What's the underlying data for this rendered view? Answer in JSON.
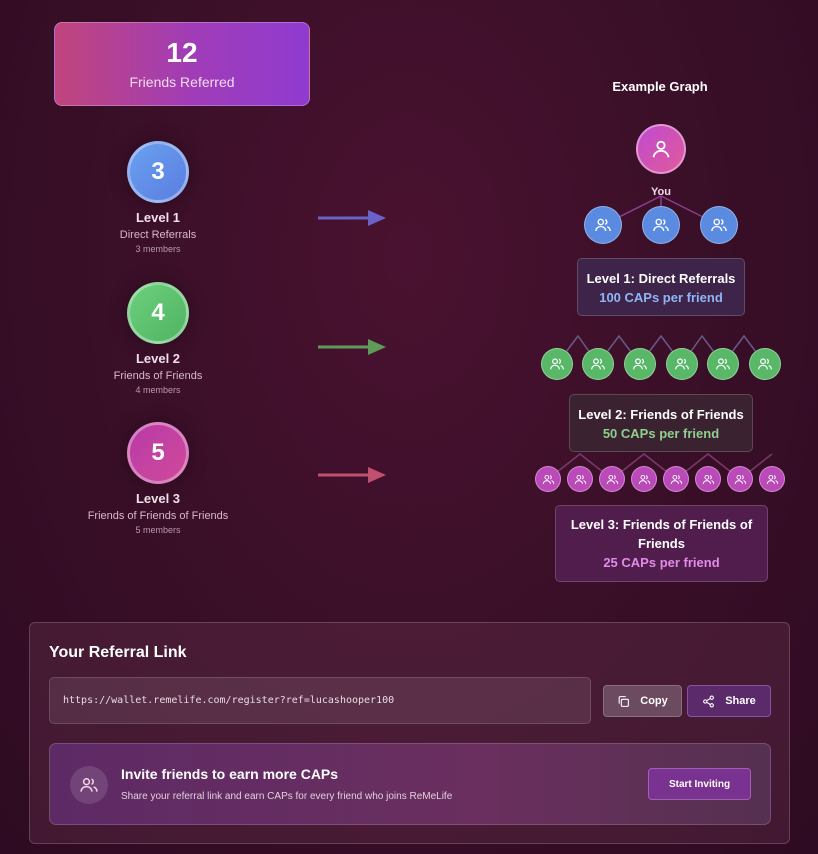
{
  "stats": {
    "count": "12",
    "label": "Friends Referred"
  },
  "levels": [
    {
      "number": "3",
      "title": "Level 1",
      "subtitle": "Direct Referrals",
      "members": "3 members"
    },
    {
      "number": "4",
      "title": "Level 2",
      "subtitle": "Friends of Friends",
      "members": "4 members"
    },
    {
      "number": "5",
      "title": "Level 3",
      "subtitle": "Friends of Friends of Friends",
      "members": "5 members"
    }
  ],
  "graph": {
    "title": "Example Graph",
    "you_label": "You",
    "boxes": [
      {
        "title": "Level 1: Direct Referrals",
        "reward": "100 CAPs per friend"
      },
      {
        "title": "Level 2: Friends of Friends",
        "reward": "50 CAPs per friend"
      },
      {
        "title": "Level 3: Friends of Friends of Friends",
        "reward": "25 CAPs per friend"
      }
    ]
  },
  "referral": {
    "title": "Your Referral Link",
    "link": "https://wallet.remelife.com/register?ref=lucashooper100",
    "copy_label": "Copy",
    "share_label": "Share"
  },
  "invite": {
    "title": "Invite friends to earn more CAPs",
    "subtitle": "Share your referral link and earn CAPs for every friend who joins ReMeLife",
    "button_label": "Start Inviting"
  },
  "colors": {
    "level1": "#5b8be0",
    "level2": "#58b868",
    "level3": "#b94ab8",
    "arrow1": "#6a62c8",
    "arrow2": "#5e9a58",
    "arrow3": "#c0506e"
  },
  "icons": {
    "you": "user-icon",
    "friend": "users-icon",
    "copy": "copy-icon",
    "share": "share-icon"
  }
}
